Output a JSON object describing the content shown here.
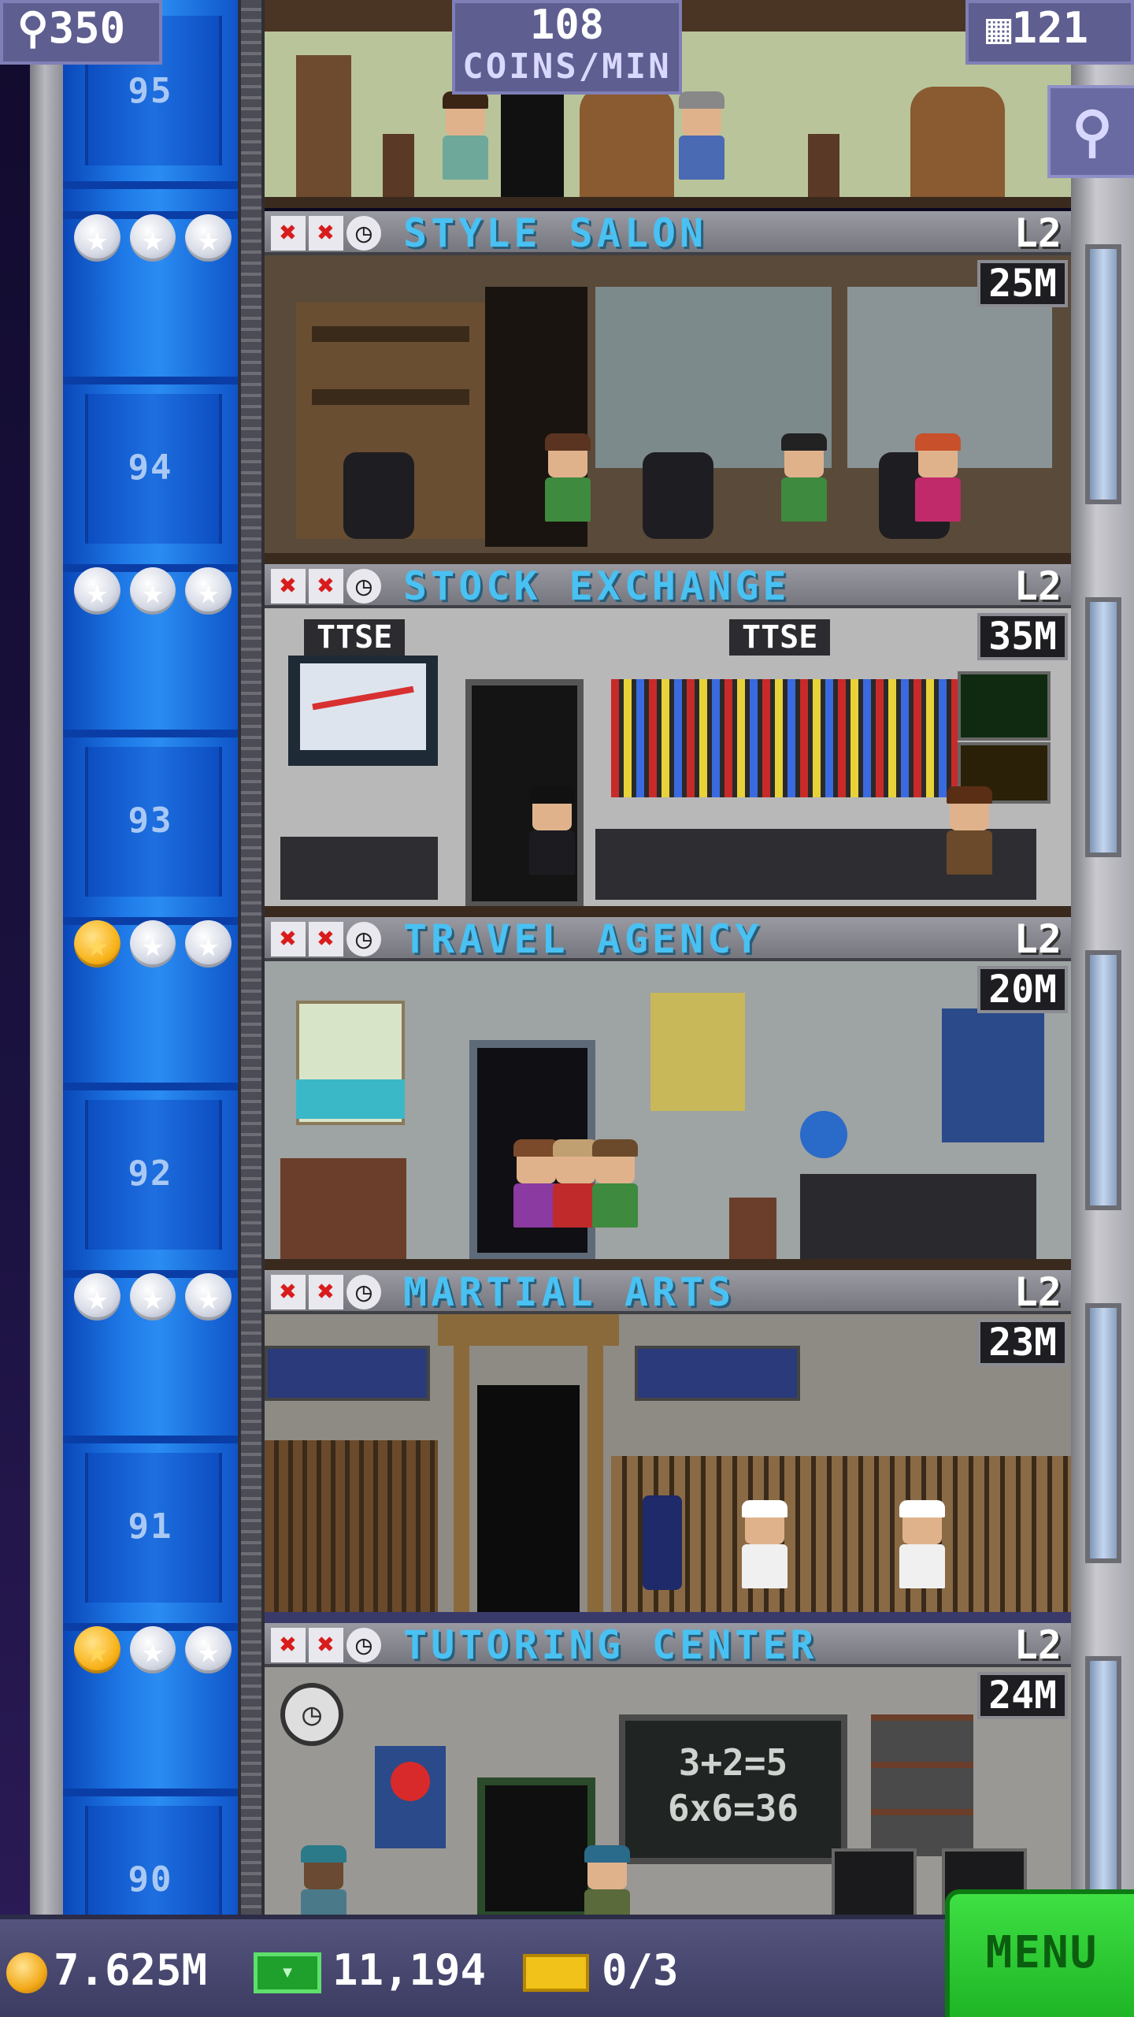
{
  "header": {
    "population": "350",
    "coins_rate_value": "108",
    "coins_rate_unit": "COINS/MIN",
    "floors_count": "121",
    "person_icon": "person-icon",
    "building_icon": "building-icon",
    "search_icon": "magnifier-icon"
  },
  "top_floor": {
    "number": "95"
  },
  "floors": [
    {
      "number": "94",
      "name": "STYLE SALON",
      "level": "L2",
      "cost": "25M",
      "stars_gold": 0,
      "stars_total": 3
    },
    {
      "number": "93",
      "name": "STOCK EXCHANGE",
      "level": "L2",
      "cost": "35M",
      "stars_gold": 0,
      "stars_total": 3,
      "signs": [
        "TTSE",
        "TTSE"
      ]
    },
    {
      "number": "92",
      "name": "TRAVEL AGENCY",
      "level": "L2",
      "cost": "20M",
      "stars_gold": 1,
      "stars_total": 3
    },
    {
      "number": "91",
      "name": "MARTIAL ARTS",
      "level": "L2",
      "cost": "23M",
      "stars_gold": 0,
      "stars_total": 3
    },
    {
      "number": "90",
      "name": "TUTORING CENTER",
      "level": "L2",
      "cost": "24M",
      "stars_gold": 1,
      "stars_total": 3,
      "chalkboard": [
        "3+2=5",
        "6x6=36"
      ]
    }
  ],
  "status_icons": [
    "x-icon",
    "x-icon",
    "clock-icon"
  ],
  "footer": {
    "coins": "7.625M",
    "bux": "11,194",
    "tickets": "0/3",
    "menu_label": "MENU"
  },
  "colors": {
    "shaft_blue": "#1f7ae8",
    "room_name_cyan": "#49c1f2",
    "menu_green": "#2fd034",
    "header_purple": "#5e5e90"
  }
}
